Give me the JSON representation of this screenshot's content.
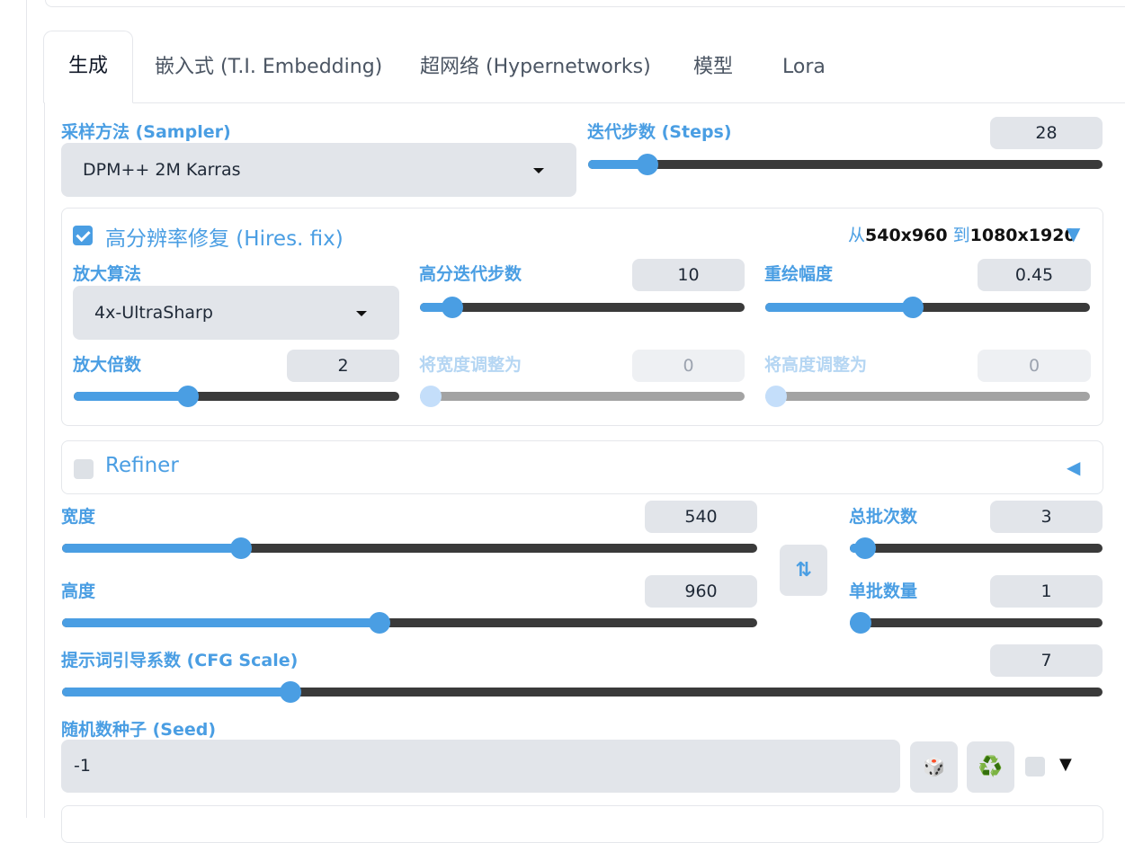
{
  "tabs": [
    {
      "label": "生成",
      "active": true
    },
    {
      "label": "嵌入式 (T.I. Embedding)"
    },
    {
      "label": "超网络 (Hypernetworks)"
    },
    {
      "label": "模型"
    },
    {
      "label": "Lora"
    }
  ],
  "sampler": {
    "label": "采样方法 (Sampler)",
    "value": "DPM++ 2M Karras"
  },
  "steps": {
    "label": "迭代步数 (Steps)",
    "value": "28",
    "fraction": 0.098
  },
  "hires": {
    "title": "高分辨率修复 (Hires. fix)",
    "enabled": true,
    "summary_from": "从",
    "summary_from_size": "540x960",
    "summary_to": " 到",
    "summary_to_size": "1080x1920",
    "toggle_glyph": "▼",
    "upscaler": {
      "label": "放大算法",
      "value": "4x-UltraSharp"
    },
    "hires_steps": {
      "label": "高分迭代步数",
      "value": "10",
      "fraction": 0.07
    },
    "denoise": {
      "label": "重绘幅度",
      "value": "0.45",
      "fraction": 0.45
    },
    "scale": {
      "label": "放大倍数",
      "value": "2",
      "fraction": 0.34
    },
    "resize_width": {
      "label": "将宽度调整为",
      "value": "0",
      "fraction": 0
    },
    "resize_height": {
      "label": "将高度调整为",
      "value": "0",
      "fraction": 0
    }
  },
  "refiner": {
    "title": "Refiner",
    "enabled": false,
    "toggle_glyph": "◀"
  },
  "width": {
    "label": "宽度",
    "value": "540",
    "fraction": 0.25
  },
  "height": {
    "label": "高度",
    "value": "960",
    "fraction": 0.455
  },
  "swap_icon": "⇅",
  "batch_count": {
    "label": "总批次数",
    "value": "3",
    "fraction": 0.02
  },
  "batch_size": {
    "label": "单批数量",
    "value": "1",
    "fraction": 0
  },
  "cfg": {
    "label": "提示词引导系数 (CFG Scale)",
    "value": "7",
    "fraction": 0.214
  },
  "seed": {
    "label": "随机数种子 (Seed)",
    "value": "-1",
    "dice_icon": "🎲",
    "recycle_icon": "♻️",
    "extra_glyph": "▼"
  },
  "colors": {
    "accent": "#4a9ee3",
    "track": "#3a3a3a",
    "field": "#e2e5ea"
  }
}
